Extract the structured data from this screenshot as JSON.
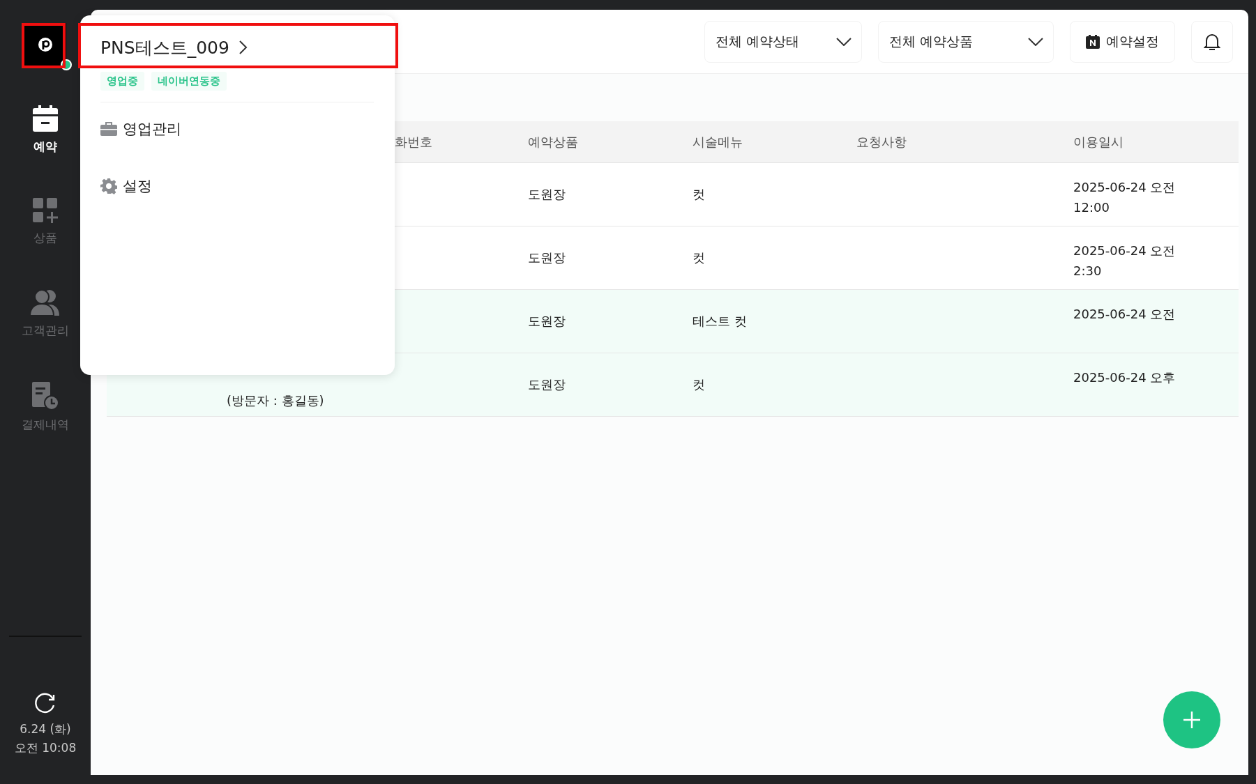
{
  "sidebar": {
    "logo": {
      "online": true
    },
    "nav": [
      {
        "label": "예약",
        "kind": "calendar",
        "selected": true
      },
      {
        "label": "상품",
        "kind": "grid",
        "selected": false
      },
      {
        "label": "고객관리",
        "kind": "people",
        "selected": false
      },
      {
        "label": "결제내역",
        "kind": "receipt",
        "selected": false
      }
    ],
    "clock": {
      "date": "6.24 (화)",
      "time": "오전 10:08"
    }
  },
  "toolbar": {
    "filters": [
      {
        "label": "전체 예약상태"
      },
      {
        "label": "전체 예약상품"
      }
    ],
    "settings_button": {
      "label": "예약설정"
    }
  },
  "table": {
    "columns": [
      "화번호",
      "예약상품",
      "시술메뉴",
      "요청사항",
      "이용일시"
    ],
    "rows": [
      {
        "highlighted": false,
        "product": "도원장",
        "menu": "컷",
        "datetime": [
          "2025-06-24 오전",
          "12:00"
        ]
      },
      {
        "highlighted": false,
        "product": "도원장",
        "menu": "컷",
        "datetime": [
          "2025-06-24 오전",
          "2:30"
        ]
      },
      {
        "highlighted": true,
        "product": "도원장",
        "menu": "테스트 컷",
        "datetime": [
          "2025-06-24 오전"
        ]
      },
      {
        "highlighted": true,
        "visitor": "(방문자 : 홍길동)",
        "product": "도원장",
        "menu": "컷",
        "datetime": [
          "2025-06-24 오후"
        ]
      }
    ]
  },
  "store_menu": {
    "store_name": "PNS테스트_009",
    "tags": [
      "영업중",
      "네이버연동중"
    ],
    "items": [
      {
        "label": "영업관리",
        "kind": "briefcase"
      },
      {
        "label": "설정",
        "kind": "gear"
      }
    ]
  }
}
